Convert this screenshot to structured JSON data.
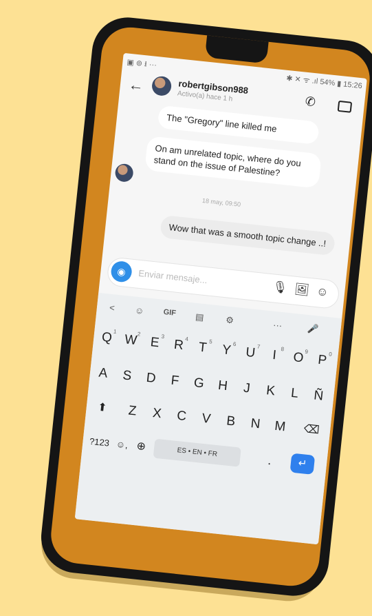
{
  "status": {
    "left_icons": "▣ ⊚ ⭳ ···",
    "right": "✱ ✕ ᯤ .ıl 54% ▮ 15:26"
  },
  "header": {
    "username": "robertgibson988",
    "active": "Activo(a) hace 1 h"
  },
  "messages": [
    {
      "text": "The \"Gregory\" line killed me"
    },
    {
      "text": "On am unrelated topic, where do you stand on the issue of Palestine?"
    },
    {
      "text": "Wow that was a smooth topic change ..!"
    }
  ],
  "timestamp": "18 may, 09:50",
  "composer": {
    "placeholder": "Enviar mensaje..."
  },
  "keyboard": {
    "toolbar": [
      "<",
      "☺",
      "GIF",
      "▤",
      "⚙",
      "···",
      "🎤"
    ],
    "row1": [
      {
        "k": "Q",
        "h": "1"
      },
      {
        "k": "W",
        "h": "2"
      },
      {
        "k": "E",
        "h": "3"
      },
      {
        "k": "R",
        "h": "4"
      },
      {
        "k": "T",
        "h": "5"
      },
      {
        "k": "Y",
        "h": "6"
      },
      {
        "k": "U",
        "h": "7"
      },
      {
        "k": "I",
        "h": "8"
      },
      {
        "k": "O",
        "h": "9"
      },
      {
        "k": "P",
        "h": "0"
      }
    ],
    "row2": [
      "A",
      "S",
      "D",
      "F",
      "G",
      "H",
      "J",
      "K",
      "L",
      "Ñ"
    ],
    "row3": [
      "Z",
      "X",
      "C",
      "V",
      "B",
      "N",
      "M"
    ],
    "shift": "⬆",
    "backspace": "⌫",
    "symbols": "?123",
    "comma": "☺,",
    "globe": "⊕",
    "space": "ES • EN • FR",
    "period": ".",
    "enter": "↵"
  }
}
